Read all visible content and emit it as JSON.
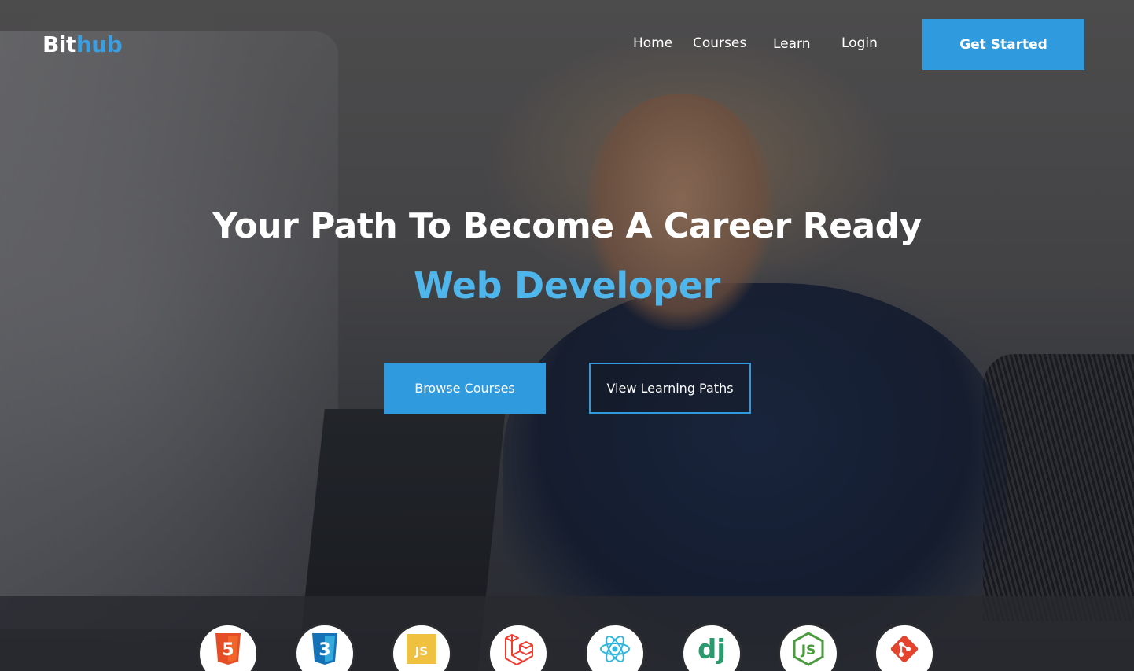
{
  "brand": {
    "part1": "Bit",
    "part2": "hub"
  },
  "nav": {
    "home": "Home",
    "courses": "Courses",
    "learn": "Learn",
    "login": "Login",
    "cta": "Get Started"
  },
  "hero": {
    "headline": "Your Path To Become A Career Ready",
    "highlight": "Web Developer",
    "primary_button": "Browse Courses",
    "secondary_button": "View Learning Paths"
  },
  "technologies": [
    {
      "name": "html5-icon",
      "label": "5",
      "color": "#e44d26"
    },
    {
      "name": "css3-icon",
      "label": "3",
      "color": "#1572b6"
    },
    {
      "name": "javascript-icon",
      "label": "JS",
      "color": "#f0c040"
    },
    {
      "name": "laravel-icon",
      "label": "",
      "color": "#ef3b2d"
    },
    {
      "name": "react-icon",
      "label": "",
      "color": "#2fb7e0"
    },
    {
      "name": "django-icon",
      "label": "dj",
      "color": "#2b9a6e"
    },
    {
      "name": "nodejs-icon",
      "label": "JS",
      "color": "#4a9a3e"
    },
    {
      "name": "git-icon",
      "label": "",
      "color": "#e4442e"
    }
  ],
  "colors": {
    "accent": "#2f9ade",
    "highlight": "#4fb6ec"
  }
}
